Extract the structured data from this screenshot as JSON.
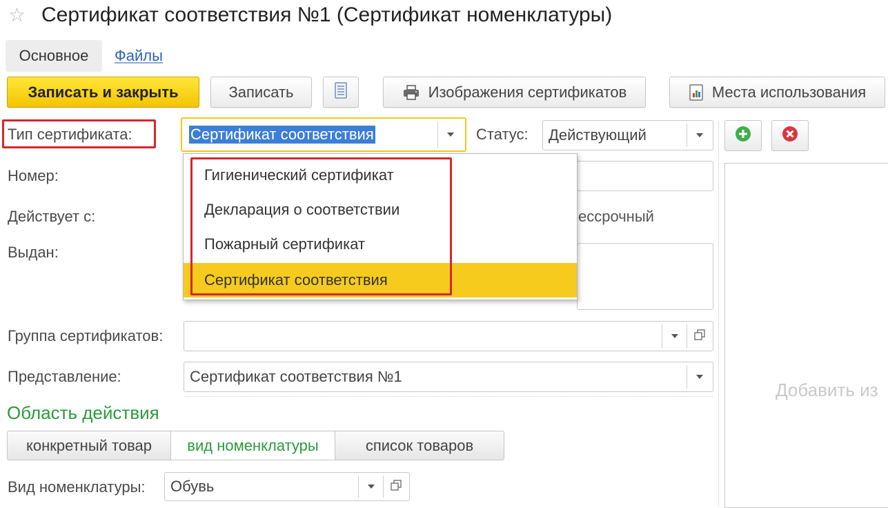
{
  "window": {
    "title": "Сертификат соответствия №1 (Сертификат номенклатуры)"
  },
  "tabs": [
    {
      "label": "Основное",
      "active": true
    },
    {
      "label": "Файлы",
      "active": false
    }
  ],
  "toolbar": {
    "save_close": "Записать и закрыть",
    "save": "Записать",
    "images": "Изображения сертификатов",
    "places": "Места использования"
  },
  "form": {
    "type_label": "Тип сертификата:",
    "type_value": "Сертификат соответствия",
    "status_label": "Статус:",
    "status_value": "Действующий",
    "number_label": "Номер:",
    "valid_from_label": "Действует с:",
    "indefinite_label": "ессрочный",
    "issued_label": "Выдан:",
    "group_label": "Группа сертификатов:",
    "group_value": "",
    "presentation_label": "Представление:",
    "presentation_value": "Сертификат соответствия №1"
  },
  "dropdown": {
    "options": [
      "Гигиенический сертификат",
      "Декларация о соответствии",
      "Пожарный сертификат",
      "Сертификат соответствия"
    ],
    "selected": "Сертификат соответствия"
  },
  "scope": {
    "title": "Область действия",
    "segments": [
      {
        "label": "конкретный товар",
        "active": false
      },
      {
        "label": "вид номенклатуры",
        "active": true
      },
      {
        "label": "список товаров",
        "active": false
      }
    ],
    "kind_label": "Вид номенклатуры:",
    "kind_value": "Обувь"
  },
  "images_panel": {
    "placeholder": "Добавить из"
  },
  "icons": {
    "favorite": "star-icon",
    "list": "list-icon",
    "print": "printer-icon",
    "places": "report-icon",
    "add": "add-circle-icon",
    "delete": "delete-circle-icon"
  },
  "colors": {
    "primary_button": "#f3c500",
    "selected_option": "#f7cb1e",
    "highlight_frame": "#d6262c",
    "section_title": "#2a9a3c",
    "link": "#2a63b5"
  }
}
